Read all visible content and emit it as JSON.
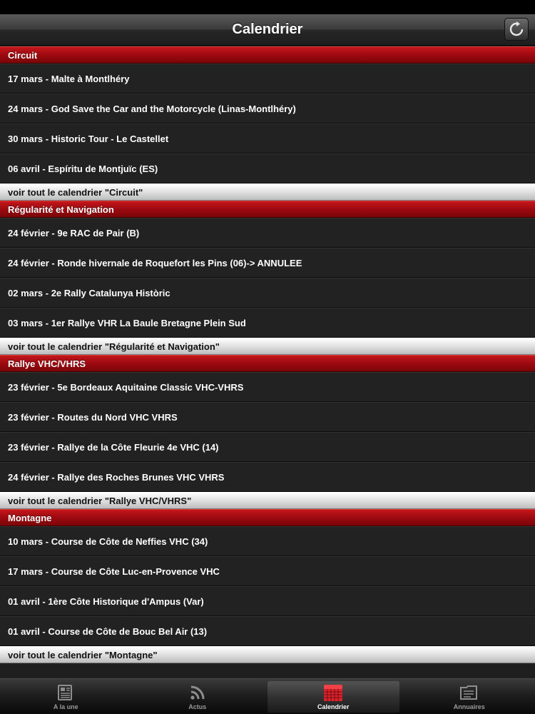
{
  "nav": {
    "title": "Calendrier",
    "refresh_icon": "refresh-icon"
  },
  "sections": [
    {
      "title": "Circuit",
      "events": [
        "17 mars -  Malte à Montlhéry",
        "24 mars -  God Save the Car and the Motorcycle (Linas-Montlhéry)",
        "30 mars -  Historic Tour - Le Castellet",
        "06 avril -  Espíritu de Montjuïc (ES)"
      ],
      "see_all": "voir tout le calendrier \"Circuit\""
    },
    {
      "title": "Régularité et Navigation",
      "events": [
        "24 février -  9e RAC de Pair (B)",
        "24 février -  Ronde hivernale de Roquefort les Pins (06)-> ANNULEE",
        "02 mars -  2e Rally Catalunya Històric",
        "03 mars -  1er Rallye VHR La Baule Bretagne Plein Sud"
      ],
      "see_all": "voir tout le calendrier \"Régularité et Navigation\""
    },
    {
      "title": "Rallye VHC/VHRS",
      "events": [
        "23 février -  5e Bordeaux Aquitaine Classic VHC-VHRS",
        "23 février -  Routes du Nord VHC VHRS",
        "23 février -  Rallye de la Côte Fleurie 4e VHC (14)",
        "24 février -  Rallye des Roches Brunes VHC VHRS"
      ],
      "see_all": "voir tout le calendrier \"Rallye VHC/VHRS\""
    },
    {
      "title": "Montagne",
      "events": [
        "10 mars -  Course de Côte de Neffies VHC (34)",
        "17 mars -  Course de Côte Luc-en-Provence VHC",
        "01 avril -  1ère Côte Historique d'Ampus (Var)",
        "01 avril -  Course de Côte de Bouc Bel Air (13)"
      ],
      "see_all": "voir tout le calendrier \"Montagne\""
    }
  ],
  "tabs": [
    {
      "label": "A la une",
      "icon": "newspaper-icon",
      "selected": false
    },
    {
      "label": "Actus",
      "icon": "rss-icon",
      "selected": false
    },
    {
      "label": "Calendrier",
      "icon": "calendar-icon",
      "selected": true
    },
    {
      "label": "Annuaires",
      "icon": "directory-icon",
      "selected": false
    }
  ],
  "colors": {
    "section_red": "#9c0a10",
    "calendar_icon_red": "#d8242c"
  }
}
